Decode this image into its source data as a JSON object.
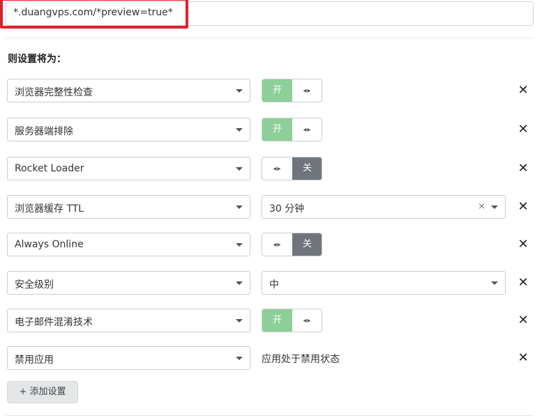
{
  "url_pattern": {
    "value": "*.duangvps.com/*preview=true*",
    "highlight_color": "#e0202a"
  },
  "section_title": "则设置将为：",
  "settings": [
    {
      "setting": "浏览器完整性检查",
      "control": "toggle",
      "state": "on",
      "on_label": "开",
      "off_label": "关",
      "handle_icon": "left-right-arrows-icon"
    },
    {
      "setting": "服务器端排除",
      "control": "toggle",
      "state": "on",
      "on_label": "开",
      "off_label": "关",
      "handle_icon": "left-right-arrows-icon"
    },
    {
      "setting": "Rocket Loader",
      "control": "toggle",
      "state": "off",
      "on_label": "开",
      "off_label": "关",
      "handle_icon": "left-right-arrows-icon"
    },
    {
      "setting": "浏览器缓存 TTL",
      "control": "select",
      "value": "30 分钟",
      "clearable": true
    },
    {
      "setting": "Always Online",
      "control": "toggle",
      "state": "off",
      "on_label": "开",
      "off_label": "关",
      "handle_icon": "left-right-arrows-icon"
    },
    {
      "setting": "安全级别",
      "control": "select",
      "value": "中",
      "clearable": false
    },
    {
      "setting": "电子邮件混淆技术",
      "control": "toggle",
      "state": "on",
      "on_label": "开",
      "off_label": "关",
      "handle_icon": "left-right-arrows-icon"
    },
    {
      "setting": "禁用应用",
      "control": "text",
      "value": "应用处于禁用状态"
    }
  ],
  "add_button": "+ 添加设置",
  "colors": {
    "toggle_on": "#8ccf98",
    "toggle_off": "#6f757a"
  }
}
